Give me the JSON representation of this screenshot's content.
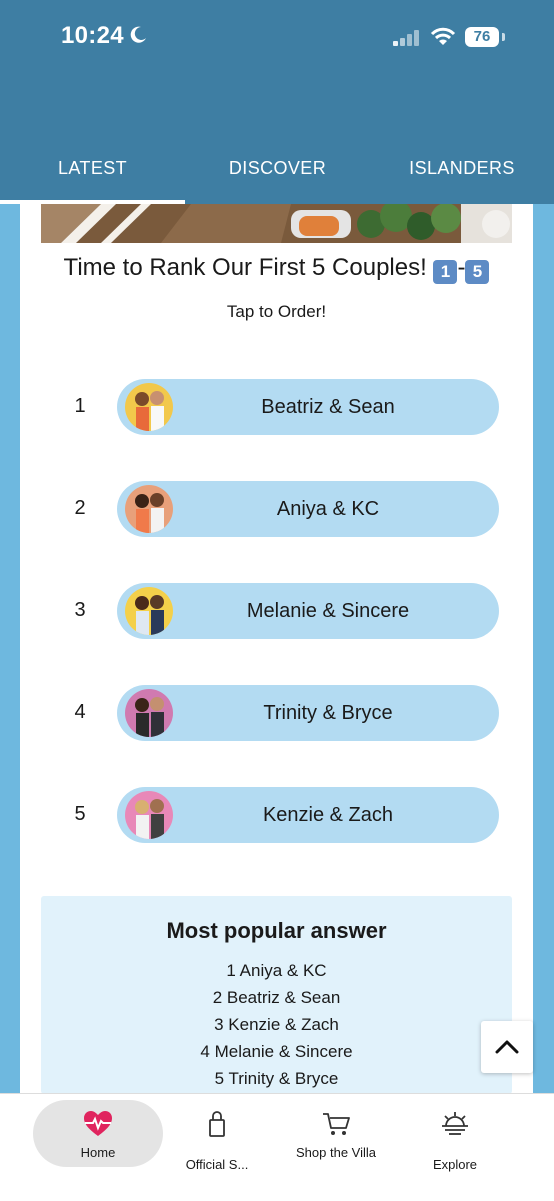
{
  "status_bar": {
    "time": "10:24",
    "battery": "76"
  },
  "tabs": [
    {
      "label": "LATEST",
      "active": true
    },
    {
      "label": "DISCOVER",
      "active": false
    },
    {
      "label": "ISLANDERS",
      "active": false
    }
  ],
  "quiz": {
    "title": "Time to Rank Our First 5 Couples!",
    "title_emoji_start": "1",
    "title_dash": "-",
    "title_emoji_end": "5",
    "subtitle": "Tap to Order!",
    "items": [
      {
        "rank": "1",
        "label": "Beatriz & Sean"
      },
      {
        "rank": "2",
        "label": "Aniya & KC"
      },
      {
        "rank": "3",
        "label": "Melanie & Sincere"
      },
      {
        "rank": "4",
        "label": "Trinity & Bryce"
      },
      {
        "rank": "5",
        "label": "Kenzie & Zach"
      }
    ]
  },
  "popular": {
    "title": "Most popular answer",
    "lines": [
      "1 Aniya & KC",
      "2 Beatriz & Sean",
      "3 Kenzie & Zach",
      "4 Melanie & Sincere",
      "5 Trinity & Bryce"
    ]
  },
  "bottom_nav": [
    {
      "label": "Home",
      "icon": "heart-pulse-icon"
    },
    {
      "label": "Official S...",
      "icon": "shopping-bag-icon"
    },
    {
      "label": "Shop the Villa",
      "icon": "cart-icon"
    },
    {
      "label": "Explore",
      "icon": "sunset-icon"
    }
  ],
  "colors": {
    "header": "#3e7ea3",
    "pill": "#b3dbf2",
    "popular_bg": "#e1f2fb",
    "accent_heart": "#e0245e",
    "page_bg": "#6eb8df"
  }
}
